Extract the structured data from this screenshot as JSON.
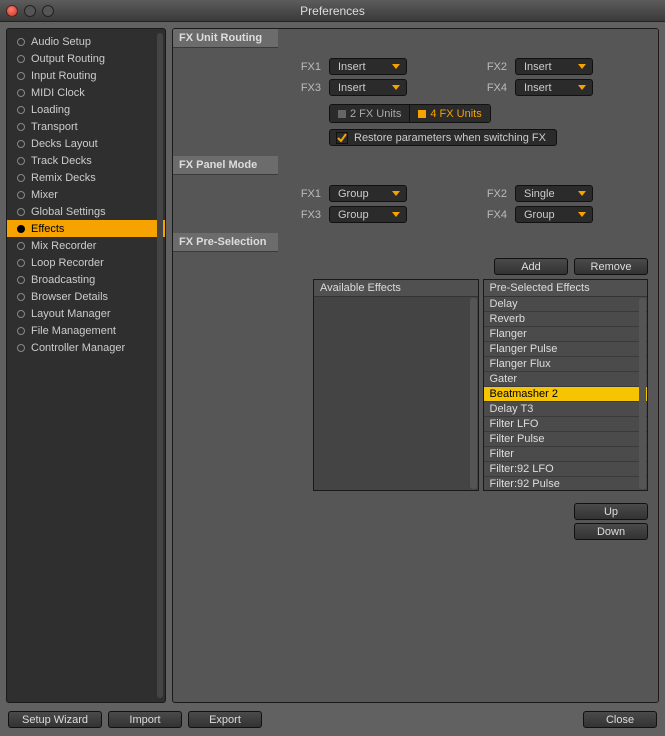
{
  "title": "Preferences",
  "sidebar": {
    "items": [
      {
        "label": "Audio Setup"
      },
      {
        "label": "Output Routing"
      },
      {
        "label": "Input Routing"
      },
      {
        "label": "MIDI Clock"
      },
      {
        "label": "Loading"
      },
      {
        "label": "Transport"
      },
      {
        "label": "Decks Layout"
      },
      {
        "label": "Track Decks"
      },
      {
        "label": "Remix Decks"
      },
      {
        "label": "Mixer"
      },
      {
        "label": "Global Settings"
      },
      {
        "label": "Effects"
      },
      {
        "label": "Mix Recorder"
      },
      {
        "label": "Loop Recorder"
      },
      {
        "label": "Broadcasting"
      },
      {
        "label": "Browser Details"
      },
      {
        "label": "Layout Manager"
      },
      {
        "label": "File Management"
      },
      {
        "label": "Controller Manager"
      }
    ],
    "selected_index": 11
  },
  "fx_unit_routing": {
    "header": "FX Unit Routing",
    "labels": {
      "fx1": "FX1",
      "fx2": "FX2",
      "fx3": "FX3",
      "fx4": "FX4"
    },
    "values": {
      "fx1": "Insert",
      "fx2": "Insert",
      "fx3": "Insert",
      "fx4": "Insert"
    },
    "unit_toggle": {
      "two": "2 FX Units",
      "four": "4 FX Units",
      "active": "four"
    },
    "restore_label": "Restore parameters when switching FX",
    "restore_checked": true
  },
  "fx_panel_mode": {
    "header": "FX Panel Mode",
    "labels": {
      "fx1": "FX1",
      "fx2": "FX2",
      "fx3": "FX3",
      "fx4": "FX4"
    },
    "values": {
      "fx1": "Group",
      "fx2": "Single",
      "fx3": "Group",
      "fx4": "Group"
    }
  },
  "fx_pre_selection": {
    "header": "FX Pre-Selection",
    "add_label": "Add",
    "remove_label": "Remove",
    "available_header": "Available Effects",
    "preselected_header": "Pre-Selected Effects",
    "preselected_items": [
      "Delay",
      "Reverb",
      "Flanger",
      "Flanger Pulse",
      "Flanger Flux",
      "Gater",
      "Beatmasher 2",
      "Delay T3",
      "Filter LFO",
      "Filter Pulse",
      "Filter",
      "Filter:92 LFO",
      "Filter:92 Pulse"
    ],
    "preselected_selected_index": 6,
    "up_label": "Up",
    "down_label": "Down"
  },
  "footer": {
    "setup_wizard": "Setup Wizard",
    "import": "Import",
    "export": "Export",
    "close": "Close"
  }
}
